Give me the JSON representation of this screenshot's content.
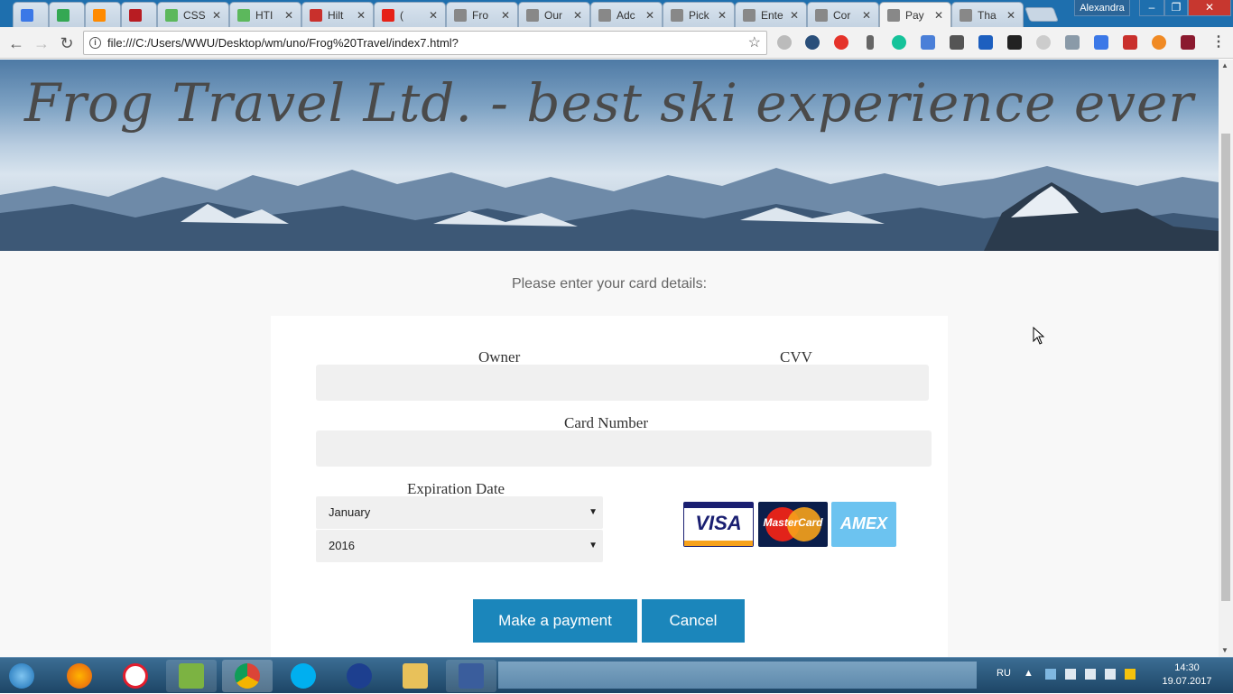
{
  "browser": {
    "tabs": [
      {
        "label": "19",
        "icon_color": "#3b78e7"
      },
      {
        "label": "",
        "icon_color": "#34a853"
      },
      {
        "label": "",
        "icon_color": "#ff8a00"
      },
      {
        "label": "",
        "icon_color": "#b81c22"
      },
      {
        "label": "CSS",
        "icon_color": "#5cb85c"
      },
      {
        "label": "HTI",
        "icon_color": "#5cb85c"
      },
      {
        "label": "Hilt",
        "icon_color": "#c9302c"
      },
      {
        "label": "(",
        "icon_color": "#e62117"
      },
      {
        "label": "Fro",
        "icon_color": "#888888"
      },
      {
        "label": "Our",
        "icon_color": "#888888"
      },
      {
        "label": "Adc",
        "icon_color": "#888888"
      },
      {
        "label": "Pick",
        "icon_color": "#888888"
      },
      {
        "label": "Ente",
        "icon_color": "#888888"
      },
      {
        "label": "Cor",
        "icon_color": "#888888"
      },
      {
        "label": "Pay",
        "icon_color": "#888888",
        "active": true
      },
      {
        "label": "Tha",
        "icon_color": "#888888"
      }
    ],
    "profile_name": "Alexandra",
    "url": "file:///C:/Users/WWU/Desktop/wm/uno/Frog%20Travel/index7.html?"
  },
  "page": {
    "hero_title": "Frog Travel Ltd. - best ski experience ever",
    "prompt": "Please enter your card details:",
    "form": {
      "owner_label": "Owner",
      "cvv_label": "CVV",
      "card_number_label": "Card Number",
      "expiration_label": "Expiration Date",
      "month_value": "January",
      "year_value": "2016",
      "owner_value": "",
      "cvv_value": "",
      "card_number_value": ""
    },
    "cards": {
      "visa": "VISA",
      "mastercard": "MasterCard",
      "amex": "AMEX"
    },
    "buttons": {
      "pay": "Make a payment",
      "cancel": "Cancel"
    }
  },
  "taskbar": {
    "language": "RU",
    "time": "14:30",
    "date": "19.07.2017"
  },
  "colors": {
    "primary_button": "#1b86bb",
    "page_background": "#f8f8f8",
    "input_background": "#f0f0f0"
  }
}
